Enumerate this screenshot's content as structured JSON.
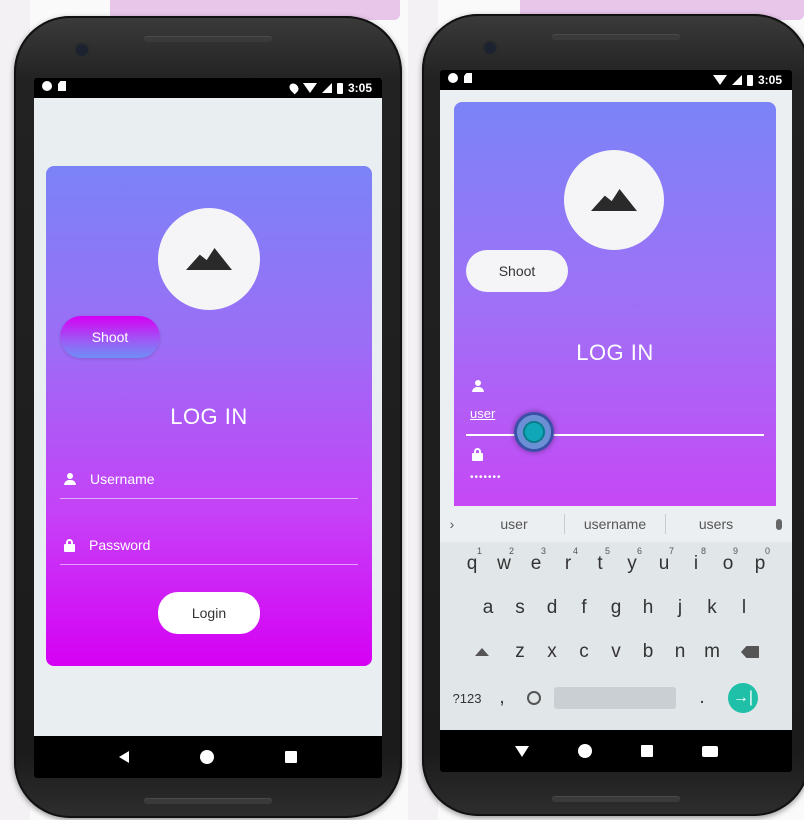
{
  "status": {
    "time_left": "3:05",
    "time_right": "3:05"
  },
  "left_screen": {
    "shoot_label": "Shoot",
    "title": "LOG IN",
    "username_placeholder": "Username",
    "password_placeholder": "Password",
    "login_label": "Login"
  },
  "right_screen": {
    "shoot_label": "Shoot",
    "title": "LOG IN",
    "username_value": "user",
    "password_mask": "•••••••",
    "suggestions": [
      "user",
      "username",
      "users"
    ],
    "keyboard": {
      "row1": [
        {
          "k": "q",
          "n": "1"
        },
        {
          "k": "w",
          "n": "2"
        },
        {
          "k": "e",
          "n": "3"
        },
        {
          "k": "r",
          "n": "4"
        },
        {
          "k": "t",
          "n": "5"
        },
        {
          "k": "y",
          "n": "6"
        },
        {
          "k": "u",
          "n": "7"
        },
        {
          "k": "i",
          "n": "8"
        },
        {
          "k": "o",
          "n": "9"
        },
        {
          "k": "p",
          "n": "0"
        }
      ],
      "row2": [
        "a",
        "s",
        "d",
        "f",
        "g",
        "h",
        "j",
        "k",
        "l"
      ],
      "row3": [
        "z",
        "x",
        "c",
        "v",
        "b",
        "n",
        "m"
      ],
      "sym_label": "?123",
      "comma": ",",
      "period": ".",
      "enter_symbol": "→|"
    }
  },
  "colors": {
    "gradient_top": "#7b83f7",
    "gradient_bottom": "#d600f4",
    "enter_key": "#1fbfa8"
  },
  "icons": [
    "mountain-icon",
    "person-icon",
    "lock-icon",
    "mic-icon",
    "shift-icon",
    "backspace-icon",
    "emoji-icon"
  ]
}
